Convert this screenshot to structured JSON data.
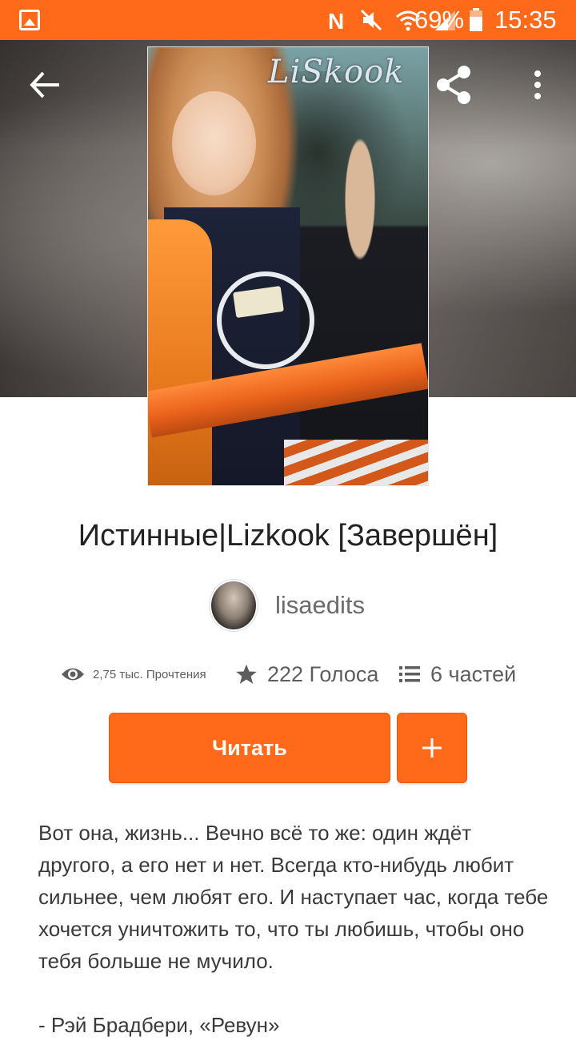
{
  "status_bar": {
    "battery_percent": "69%",
    "time": "15:35",
    "icons": [
      "image-notification-icon",
      "nfc-icon",
      "mute-icon",
      "wifi-icon",
      "signal-icon",
      "battery-icon"
    ]
  },
  "toolbar": {
    "back_icon": "arrow-left-icon",
    "share_icon": "share-icon",
    "more_icon": "more-vertical-icon"
  },
  "cover": {
    "overlay_text": "LiSkook"
  },
  "story": {
    "title": "Истинные|Lizkook [Завершён]",
    "author": "lisaedits"
  },
  "stats": {
    "reads": "2,75 тыс. Прочтения",
    "votes": "222 Голоса",
    "parts": "6 частей"
  },
  "actions": {
    "read_label": "Читать",
    "add_label": "+"
  },
  "description": {
    "text": "Вот она, жизнь... Вечно всё то же: один ждёт другого, а его нет и нет. Всегда кто-нибудь любит сильнее, чем любят его. И наступает час, когда тебе хочется уничтожить то, что ты любишь, чтобы оно тебя больше не мучило.",
    "attribution": "- Рэй Брадбери, «Ревун»"
  },
  "colors": {
    "accent": "#ff6a1a",
    "text_primary": "#222222",
    "text_secondary": "#6b6b6b"
  }
}
